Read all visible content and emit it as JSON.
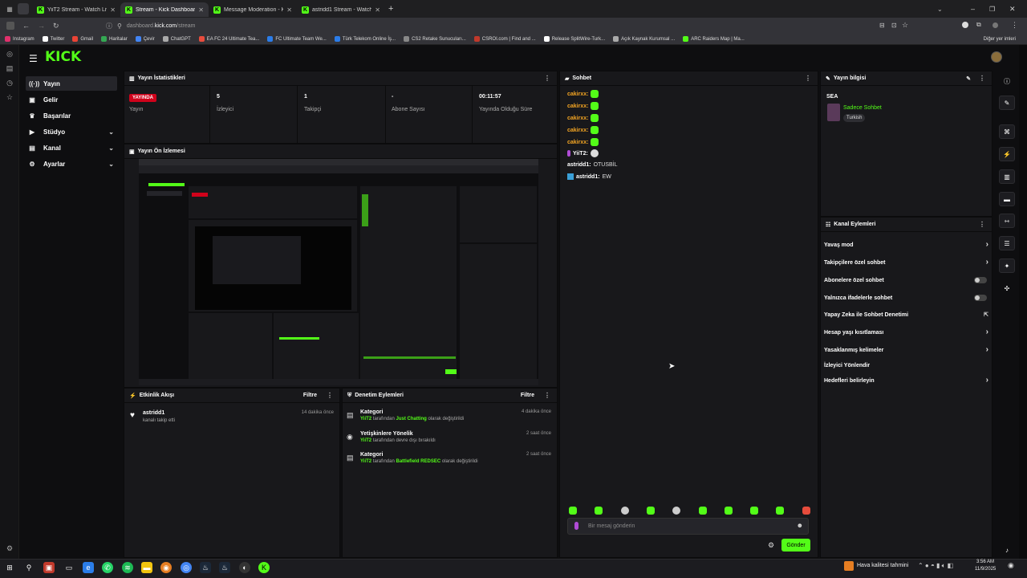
{
  "browser": {
    "tabs": [
      {
        "label": "YiiT2 Stream - Watch Live on Kick",
        "active": false
      },
      {
        "label": "Stream - Kick Dashboard",
        "active": true
      },
      {
        "label": "Message Moderation - Kick Da",
        "active": false
      },
      {
        "label": "astridd1 Stream - Watch Live o",
        "active": false
      }
    ],
    "new_tab": "+",
    "url_domain_prefix": "dashboard.",
    "url_domain": "kick.com",
    "url_path": "/stream",
    "bookmarks": [
      {
        "label": "Instagram",
        "color": "#e1306c"
      },
      {
        "label": "Twitter",
        "color": "#ffffff"
      },
      {
        "label": "Gmail",
        "color": "#ea4335"
      },
      {
        "label": "Haritalar",
        "color": "#34a853"
      },
      {
        "label": "Çevir",
        "color": "#4285f4"
      },
      {
        "label": "ChatGPT",
        "color": "#aaaaaa"
      },
      {
        "label": "EA FC 24 Ultimate Tea...",
        "color": "#e84c3d"
      },
      {
        "label": "FC Ultimate Team We...",
        "color": "#2b7de9"
      },
      {
        "label": "Türk Telekom Online İş...",
        "color": "#2b7de9"
      },
      {
        "label": "CS2 Retake Sunucuları...",
        "color": "#888888"
      },
      {
        "label": "CSROI.com | Find and ...",
        "color": "#c0392b"
      },
      {
        "label": "Release SplitWire-Turk...",
        "color": "#ffffff"
      },
      {
        "label": "Açık Kaynak Kurumsal ...",
        "color": "#aaaaaa"
      },
      {
        "label": "ARC Raiders Map | Ma...",
        "color": "#53fc18"
      }
    ],
    "other_bookmarks": "Diğer yer imleri"
  },
  "logo": "KICK",
  "nav": [
    {
      "label": "Yayın",
      "icon": "broadcast-icon",
      "glyph": "((·))",
      "expandable": false,
      "active": true
    },
    {
      "label": "Gelir",
      "icon": "money-icon",
      "glyph": "▣",
      "expandable": false,
      "active": false
    },
    {
      "label": "Başarılar",
      "icon": "trophy-icon",
      "glyph": "♛",
      "expandable": false,
      "active": false
    },
    {
      "label": "Stüdyo",
      "icon": "video-icon",
      "glyph": "▶",
      "expandable": true,
      "active": false
    },
    {
      "label": "Kanal",
      "icon": "channel-icon",
      "glyph": "▤",
      "expandable": true,
      "active": false
    },
    {
      "label": "Ayarlar",
      "icon": "gear-icon",
      "glyph": "⚙",
      "expandable": true,
      "active": false
    }
  ],
  "stats_panel": {
    "title": "Yayın İstatistikleri",
    "status_badge": "YAYINDA",
    "status_label": "Yayın",
    "viewers_value": "5",
    "viewers_label": "İzleyici",
    "followers_value": "1",
    "followers_label": "Takipçi",
    "subs_value": "-",
    "subs_label": "Abone Sayısı",
    "duration_value": "00:11:57",
    "duration_label": "Yayında Olduğu Süre"
  },
  "preview_panel": {
    "title": "Yayın Ön İzlemesi"
  },
  "activity_panel": {
    "title": "Etkinlik Akışı",
    "filter": "Filtre",
    "items": [
      {
        "user": "astridd1",
        "text": "kanalı takip etti",
        "time": "14 dakika önce"
      }
    ]
  },
  "mod_panel": {
    "title": "Denetim Eylemleri",
    "filter": "Filtre",
    "items": [
      {
        "title": "Kategori",
        "actor": "YiiT2",
        "pre": "tarafından",
        "highlight": "Just Chatting",
        "post": "olarak değiştirildi",
        "time": "4 dakika önce"
      },
      {
        "title": "Yetişkinlere Yönelik",
        "actor": "YiiT2",
        "pre": "tarafından devre dışı bırakıldı",
        "highlight": "",
        "post": "",
        "time": "2 saat önce"
      },
      {
        "title": "Kategori",
        "actor": "YiiT2",
        "pre": "tarafından",
        "highlight": "Battlefield REDSEC",
        "post": "olarak değiştirildi",
        "time": "2 saat önce"
      }
    ]
  },
  "chat_panel": {
    "title": "Sohbet",
    "messages": [
      {
        "user": "cakirxx:",
        "text": "",
        "emote": "emote-1"
      },
      {
        "user": "cakirxx:",
        "text": "",
        "emote": "emote-2"
      },
      {
        "user": "cakirxx:",
        "text": "",
        "emote": "emote-2"
      },
      {
        "user": "cakirxx:",
        "text": "",
        "emote": "emote-2"
      },
      {
        "user": "cakirxx:",
        "text": "",
        "emote": "emote-2"
      },
      {
        "user": "YiiT2:",
        "text": "",
        "emote": "emote-3"
      },
      {
        "user": "astridd1:",
        "text": "OTUSBİL",
        "emote": ""
      },
      {
        "user": "astridd1:",
        "text": "EW",
        "emote": ""
      }
    ],
    "input_placeholder": "Bir mesaj gönderin",
    "send_label": "Gönder"
  },
  "stream_info_panel": {
    "title": "Yayın bilgisi",
    "title_text": "SEA",
    "category": "Sadece Sohbet",
    "language": "Turkish"
  },
  "channel_actions_panel": {
    "title": "Kanal Eylemleri",
    "items": [
      {
        "label": "Yavaş mod",
        "type": "chevron"
      },
      {
        "label": "Takipçilere özel sohbet",
        "type": "chevron"
      },
      {
        "label": "Abonelere özel sohbet",
        "type": "toggle"
      },
      {
        "label": "Yalnızca ifadelerle sohbet",
        "type": "toggle"
      },
      {
        "label": "Yapay Zeka ile Sohbet Denetimi",
        "type": "external"
      },
      {
        "label": "Hesap yaşı kısıtlaması",
        "type": "chevron"
      },
      {
        "label": "Yasaklanmış kelimeler",
        "type": "chevron"
      },
      {
        "label": "İzleyici Yönlendir",
        "type": "none"
      },
      {
        "label": "Hedefleri belirleyin",
        "type": "chevron"
      }
    ]
  },
  "taskbar": {
    "weather": "Hava kalitesi tahmini",
    "time": "3:56 AM",
    "date": "11/9/2025"
  },
  "colors": {
    "accent": "#53fc18",
    "live": "#d0021b",
    "chat_user": "#f5a623"
  }
}
